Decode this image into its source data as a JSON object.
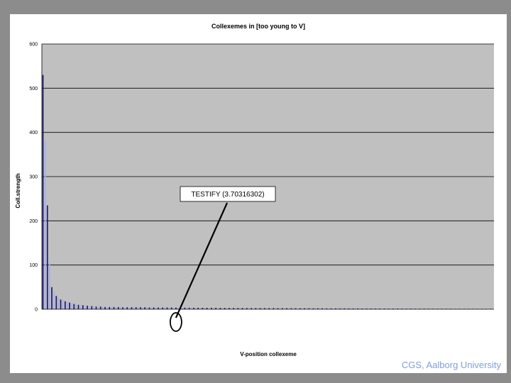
{
  "footer": "CGS, Aalborg University",
  "colors": {
    "plot_bg": "#c0c0c0",
    "bar_dark": "#1c1f6b",
    "bar_light": "#a8acec",
    "gridline": "#000000"
  },
  "chart_data": {
    "type": "bar",
    "title": "Collexemes in [too young to V]",
    "xlabel": "V-position collexeme",
    "ylabel": "Coll.strength",
    "ylim": [
      0,
      600
    ],
    "yticks": [
      0,
      100,
      200,
      300,
      400,
      500,
      600
    ],
    "grid": true,
    "annotation": {
      "text": "TESTIFY (3.70316302)",
      "category_index": 60
    },
    "categories": [],
    "values": [
      530,
      380,
      235,
      105,
      50,
      40,
      30,
      25,
      22,
      20,
      18,
      16,
      15,
      14,
      12,
      11,
      10,
      9,
      9,
      8,
      8,
      7,
      7,
      7,
      6,
      6,
      6,
      6,
      5,
      5,
      5,
      5,
      5,
      5,
      5,
      5,
      4.5,
      4.5,
      4.5,
      4.5,
      4.5,
      4.5,
      4.5,
      4.5,
      4.5,
      4.5,
      4.5,
      4.5,
      4,
      4,
      4,
      4,
      4,
      4,
      4,
      4,
      4,
      4,
      4,
      4,
      3.7,
      3.7,
      3.6,
      3.6,
      3.6,
      3.5,
      3.5,
      3.5,
      3.4,
      3.4,
      3.4,
      3.3,
      3.3,
      3.3,
      3.2,
      3.2,
      3.2,
      3.1,
      3.1,
      3.1,
      3,
      3,
      3,
      3,
      3,
      2.9,
      2.9,
      2.9,
      2.9,
      2.8,
      2.8,
      2.8,
      2.8,
      2.7,
      2.7,
      2.7,
      2.7,
      2.6,
      2.6,
      2.6,
      2.6,
      2.5,
      2.5,
      2.5,
      2.5,
      2.5,
      2.4,
      2.4,
      2.4,
      2.4,
      2.4,
      2.3,
      2.3,
      2.3,
      2.3,
      2.3,
      2.2,
      2.2,
      2.2,
      2.2,
      2.2,
      2.1,
      2.1,
      2.1,
      2.1,
      2.1,
      2,
      2,
      2,
      2,
      2,
      2,
      1.9,
      1.9,
      1.9,
      1.9,
      1.9,
      1.9,
      1.8,
      1.8,
      1.8,
      1.8,
      1.8,
      1.8,
      1.7,
      1.7,
      1.7,
      1.7,
      1.7,
      1.7,
      1.6,
      1.6,
      1.6,
      1.6,
      1.6,
      1.6,
      1.5,
      1.5,
      1.5,
      1.5,
      1.5,
      1.5,
      1.4,
      1.4,
      1.4,
      1.4,
      1.4,
      1.4,
      1.3,
      1.3,
      1.3,
      1.3,
      1.3,
      1.3,
      1.2,
      1.2,
      1.2,
      1.2,
      1.2,
      1.2,
      1.1,
      1.1,
      1.1,
      1.1,
      1.1,
      1.1,
      1,
      1,
      1,
      1,
      1,
      1,
      1,
      1,
      1,
      1,
      1,
      1,
      1,
      1,
      1,
      1,
      1,
      1
    ]
  }
}
